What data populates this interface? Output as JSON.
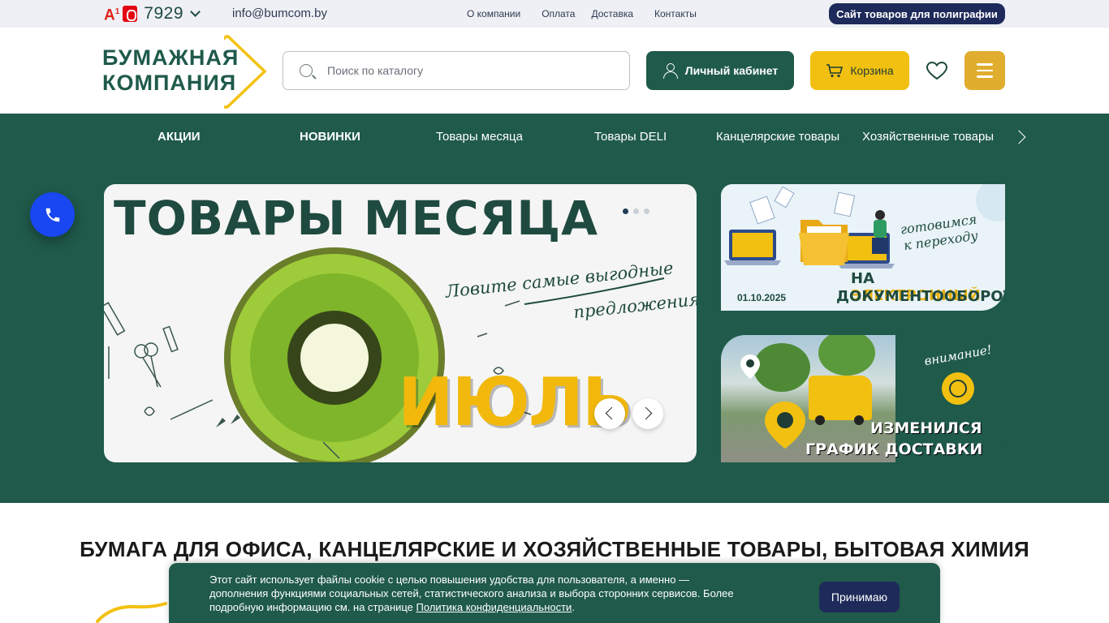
{
  "topbar": {
    "operator_a1": "A",
    "operator_a1_sup": "1",
    "phone": "7929",
    "email": "info@bumcom.by",
    "nav": [
      "О компании",
      "Оплата",
      "Доставка",
      "Контакты"
    ],
    "poly_button": "Сайт товаров для полиграфии"
  },
  "header": {
    "logo_line1": "БУМАЖНАЯ",
    "logo_line2": "КОМПАНИЯ",
    "search_placeholder": "Поиск по каталогу",
    "cabinet_label": "Личный кабинет",
    "cart_label": "Корзина"
  },
  "catnav": [
    "АКЦИИ",
    "НОВИНКИ",
    "Товары месяца",
    "Товары DELI",
    "Канцелярские товары",
    "Хозяйственные товары"
  ],
  "slider": {
    "title": "ТОВАРЫ МЕСЯЦА",
    "note_line1": "Ловите самые выгодные",
    "note_line2": "предложения",
    "month": "ИЮЛЬ",
    "dots_active": 1,
    "dots_total": 3
  },
  "banner1": {
    "hand_line1": "готовимся",
    "hand_line2": "к переходу",
    "line1_prefix": "НА ",
    "line1_accent": "ЭЛЕКТРОННЫЙ",
    "line2": "ДОКУМЕНТООБОРОТ",
    "date": "01.10.2025"
  },
  "banner2": {
    "attention": "внимание!",
    "line1": "ИЗМЕНИЛСЯ",
    "line2": "ГРАФИК ДОСТАВКИ"
  },
  "main_heading": "БУМАГА ДЛЯ ОФИСА, КАНЦЕЛЯРСКИЕ И ХОЗЯЙСТВЕННЫЕ ТОВАРЫ, БЫТОВАЯ ХИМИЯ",
  "cookie": {
    "text": "Этот сайт использует файлы cookie с целью повышения удобства для пользователя, а именно — дополнения функциями социальных сетей, статистического анализа и выбора сторонних сервисов. Более подробную информацию см. на странице ",
    "link": "Политика конфиденциальности",
    "tail": ".",
    "button": "Принимаю"
  },
  "colors": {
    "brand_green": "#1f5a4a",
    "brand_yellow": "#f2c010",
    "navy": "#1e2b5a",
    "call_blue": "#1947f1"
  },
  "icons": [
    "search-icon",
    "user-icon",
    "cart-icon",
    "heart-icon",
    "menu-icon",
    "phone-icon",
    "chevron-down-icon",
    "chevron-right-icon"
  ]
}
